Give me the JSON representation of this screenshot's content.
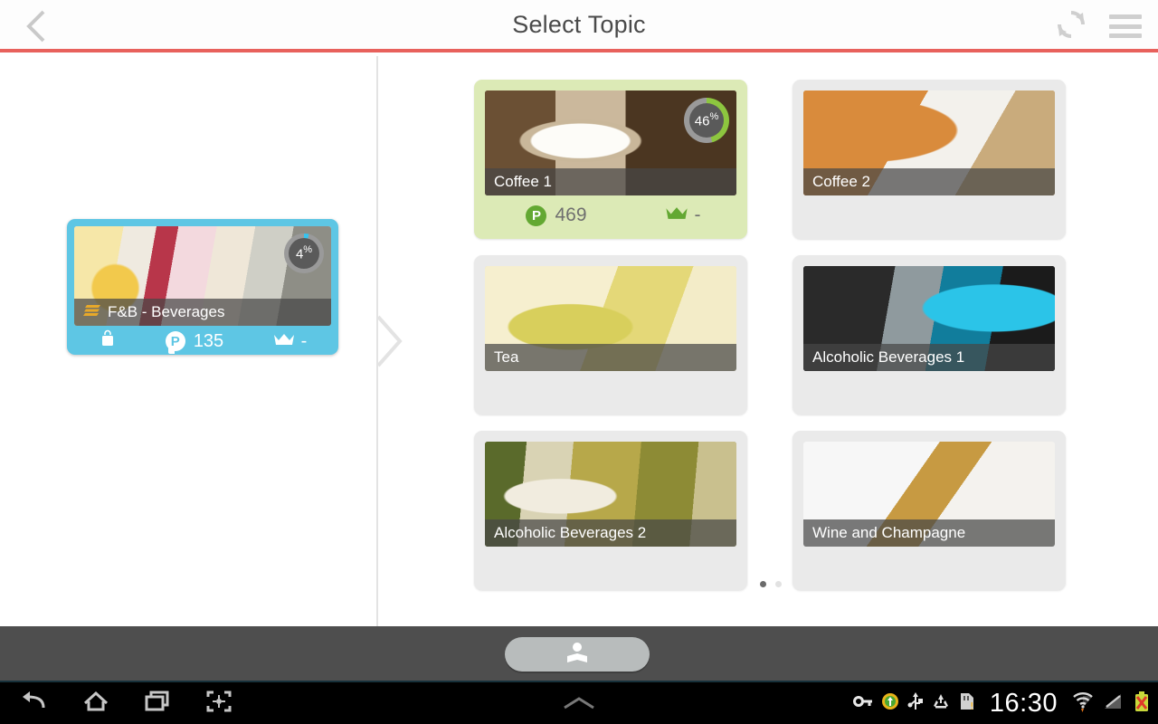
{
  "appbar": {
    "title": "Select Topic",
    "back_icon": "chevron-left-icon",
    "refresh_icon": "refresh-icon",
    "menu_icon": "hamburger-menu-icon",
    "accent_color": "#e8615c"
  },
  "category": {
    "name": "F&B - Beverages",
    "icon": "stack-layers-icon",
    "progress_pct": "4",
    "progress_value": 4,
    "progress_color": "#35c4ef",
    "card_color": "#5ec6e4",
    "bag_icon": "briefcase-icon",
    "points_icon": "points-p-icon",
    "points_value": "135",
    "crown_icon": "crown-icon",
    "crown_value": "-"
  },
  "topics": [
    {
      "name": "Coffee 1",
      "selected": true,
      "art": "art-coffee1",
      "progress_pct": "46",
      "progress_value": 46,
      "progress_color": "#8dc63f",
      "has_stats": true,
      "points_icon": "points-p-icon",
      "points_value": "469",
      "crown_icon": "crown-icon",
      "crown_value": "-"
    },
    {
      "name": "Coffee 2",
      "selected": false,
      "art": "art-coffee2",
      "has_stats": false
    },
    {
      "name": "Tea",
      "selected": false,
      "art": "art-tea",
      "has_stats": false
    },
    {
      "name": "Alcoholic Beverages 1",
      "selected": false,
      "art": "art-alco1",
      "has_stats": false
    },
    {
      "name": "Alcoholic Beverages 2",
      "selected": false,
      "art": "art-alco2",
      "has_stats": false
    },
    {
      "name": "Wine and Champagne",
      "selected": false,
      "art": "art-wine",
      "has_stats": false
    }
  ],
  "pagination": {
    "total": 2,
    "active_index": 0
  },
  "footer": {
    "read_button_icon": "person-reading-icon"
  },
  "systembar": {
    "back_icon": "android-back-icon",
    "home_icon": "android-home-icon",
    "recents_icon": "android-recents-icon",
    "screenshot_icon": "android-screenshot-icon",
    "expand_icon": "chevron-up-icon",
    "clock": "16:30",
    "tray_icons": [
      "vpn-key-icon",
      "app-update-icon",
      "usb-icon",
      "recycle-icon",
      "sd-card-warning-icon",
      "wifi-icon",
      "signal-icon",
      "battery-warning-icon"
    ]
  }
}
